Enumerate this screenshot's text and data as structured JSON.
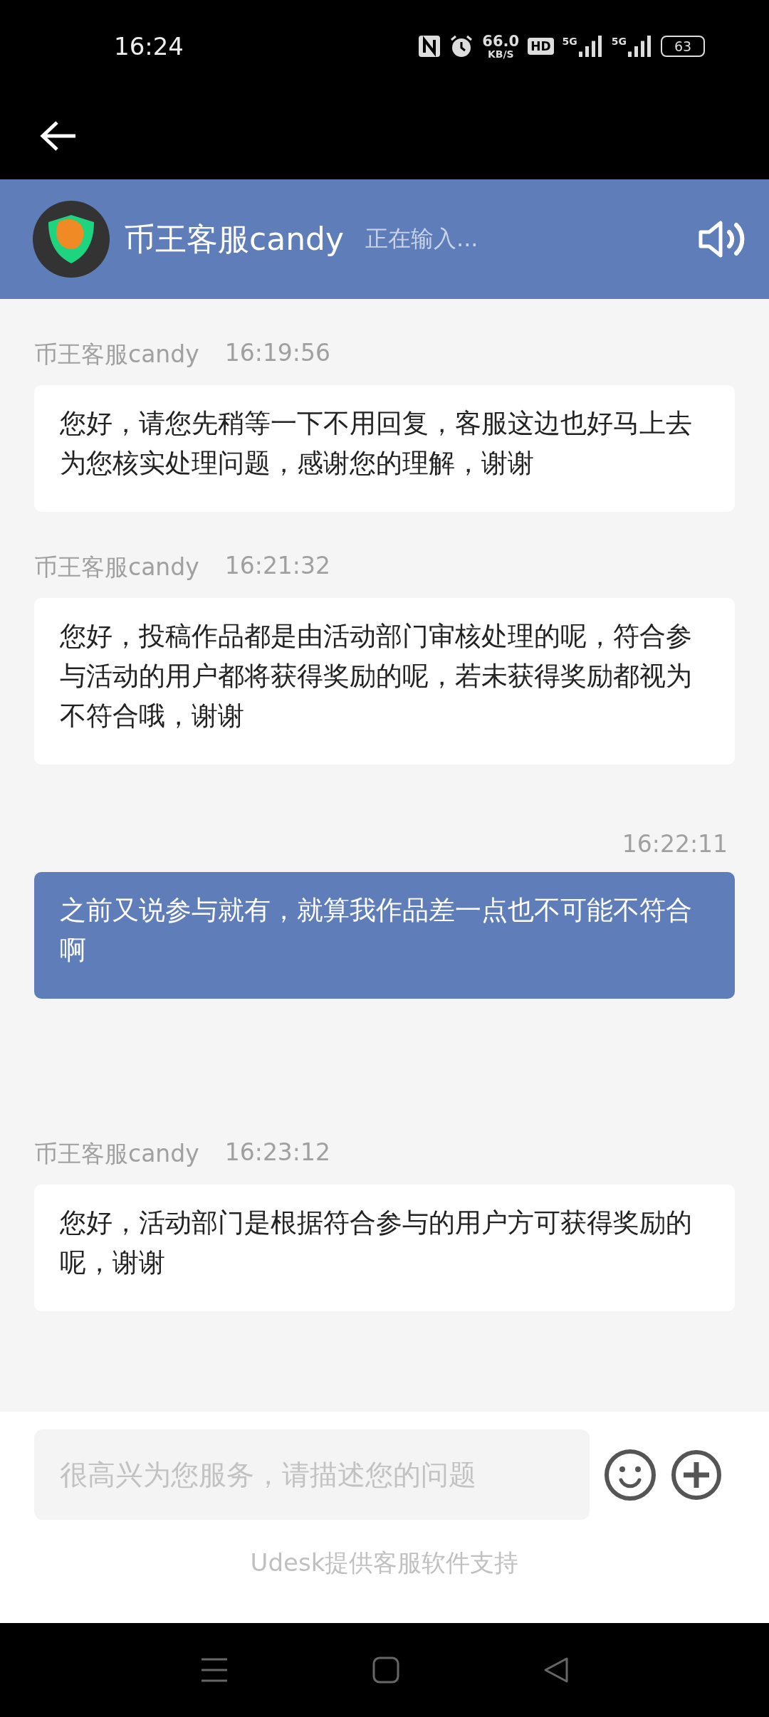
{
  "status_bar": {
    "time": "16:24",
    "network_speed": "66.0",
    "speed_unit": "KB/S",
    "hd": "HD",
    "signals": [
      {
        "label": "5G"
      },
      {
        "label": "5G"
      }
    ],
    "battery": "63"
  },
  "header": {
    "title": "币王客服candy",
    "status": "正在输入..."
  },
  "messages": [
    {
      "kind": "incoming",
      "sender": "币王客服candy",
      "time": "16:19:56",
      "text": "您好，请您先稍等一下不用回复，客服这边也好马上去为您核实处理问题，感谢您的理解，谢谢"
    },
    {
      "kind": "incoming",
      "sender": "币王客服candy",
      "time": "16:21:32",
      "text": "您好，投稿作品都是由活动部门审核处理的呢，符合参与活动的用户都将获得奖励的呢，若未获得奖励都视为不符合哦，谢谢"
    },
    {
      "kind": "outgoing",
      "time": "16:22:11",
      "text": "之前又说参与就有，就算我作品差一点也不可能不符合啊"
    },
    {
      "kind": "incoming",
      "sender": "币王客服candy",
      "time": "16:23:12",
      "text": "您好，活动部门是根据符合参与的用户方可获得奖励的呢，谢谢"
    }
  ],
  "input": {
    "placeholder": "很高兴为您服务，请描述您的问题"
  },
  "footer": "Udesk提供客服软件支持"
}
